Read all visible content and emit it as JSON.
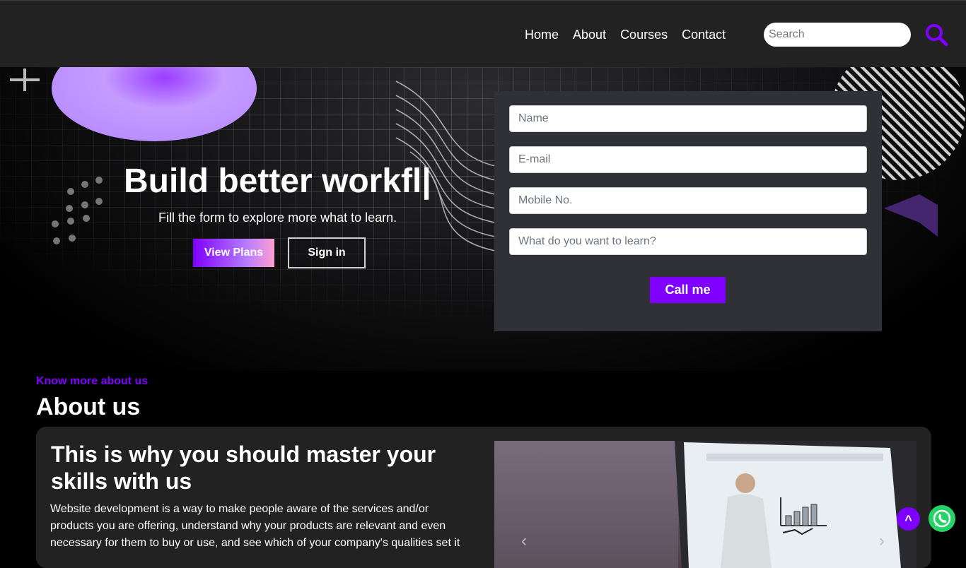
{
  "nav": {
    "links": [
      "Home",
      "About",
      "Courses",
      "Contact"
    ],
    "search_placeholder": "Search",
    "search_icon": "search-icon",
    "accent_color": "#7f00ff"
  },
  "hero": {
    "title": "Build better workfl|",
    "subtitle": "Fill the form to explore more what to learn.",
    "view_plans_label": "View Plans",
    "sign_in_label": "Sign in"
  },
  "form": {
    "name_placeholder": "Name",
    "email_placeholder": "E-mail",
    "mobile_placeholder": "Mobile No.",
    "learn_placeholder": "What do you want to learn?",
    "submit_label": "Call me"
  },
  "about": {
    "kicker": "Know more about us",
    "title": "About us",
    "card_heading": "This is why you should master your skills with us",
    "card_body": "Website development is a way to make people aware of the services and/or products you are offering, understand why your products are relevant and even necessary for them to buy or use, and see which of your company's qualities set it",
    "carousel_prev_icon": "chevron-left-icon",
    "carousel_next_icon": "chevron-right-icon"
  },
  "floating": {
    "to_top_label": "^",
    "whatsapp_icon": "whatsapp-icon"
  }
}
